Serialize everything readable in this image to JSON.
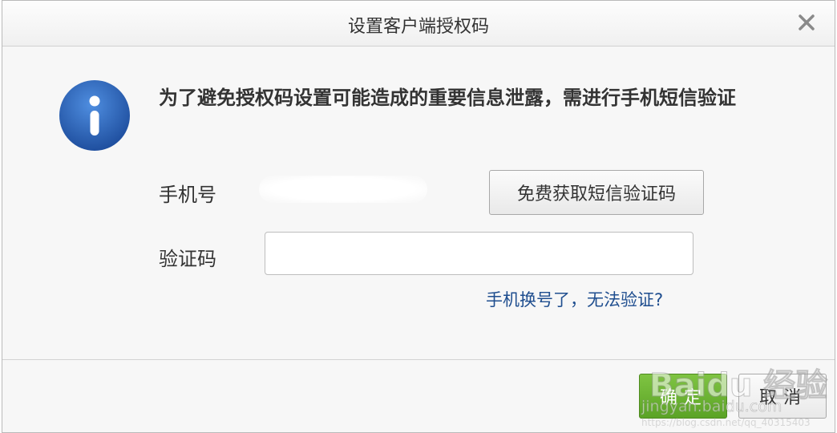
{
  "dialog": {
    "title": "设置客户端授权码",
    "close_icon": "close-icon",
    "info_icon": "info-icon",
    "message": "为了避免授权码设置可能造成的重要信息泄露，需进行手机短信验证",
    "phone_label": "手机号",
    "phone_value": "",
    "sms_button_label": "免费获取短信验证码",
    "code_label": "验证码",
    "code_value": "",
    "code_placeholder": "",
    "help_link": "手机换号了，无法验证?",
    "ok_label": "确定",
    "cancel_label": "取消"
  },
  "watermark": {
    "brand": "Baidu 经验",
    "site": "jingyan.baidu.com",
    "url": "https://blog.csdn.net/qq_40315403"
  },
  "colors": {
    "accent_green": "#5ba326",
    "link_blue": "#1f4e8f",
    "info_blue": "#2a62b8"
  }
}
